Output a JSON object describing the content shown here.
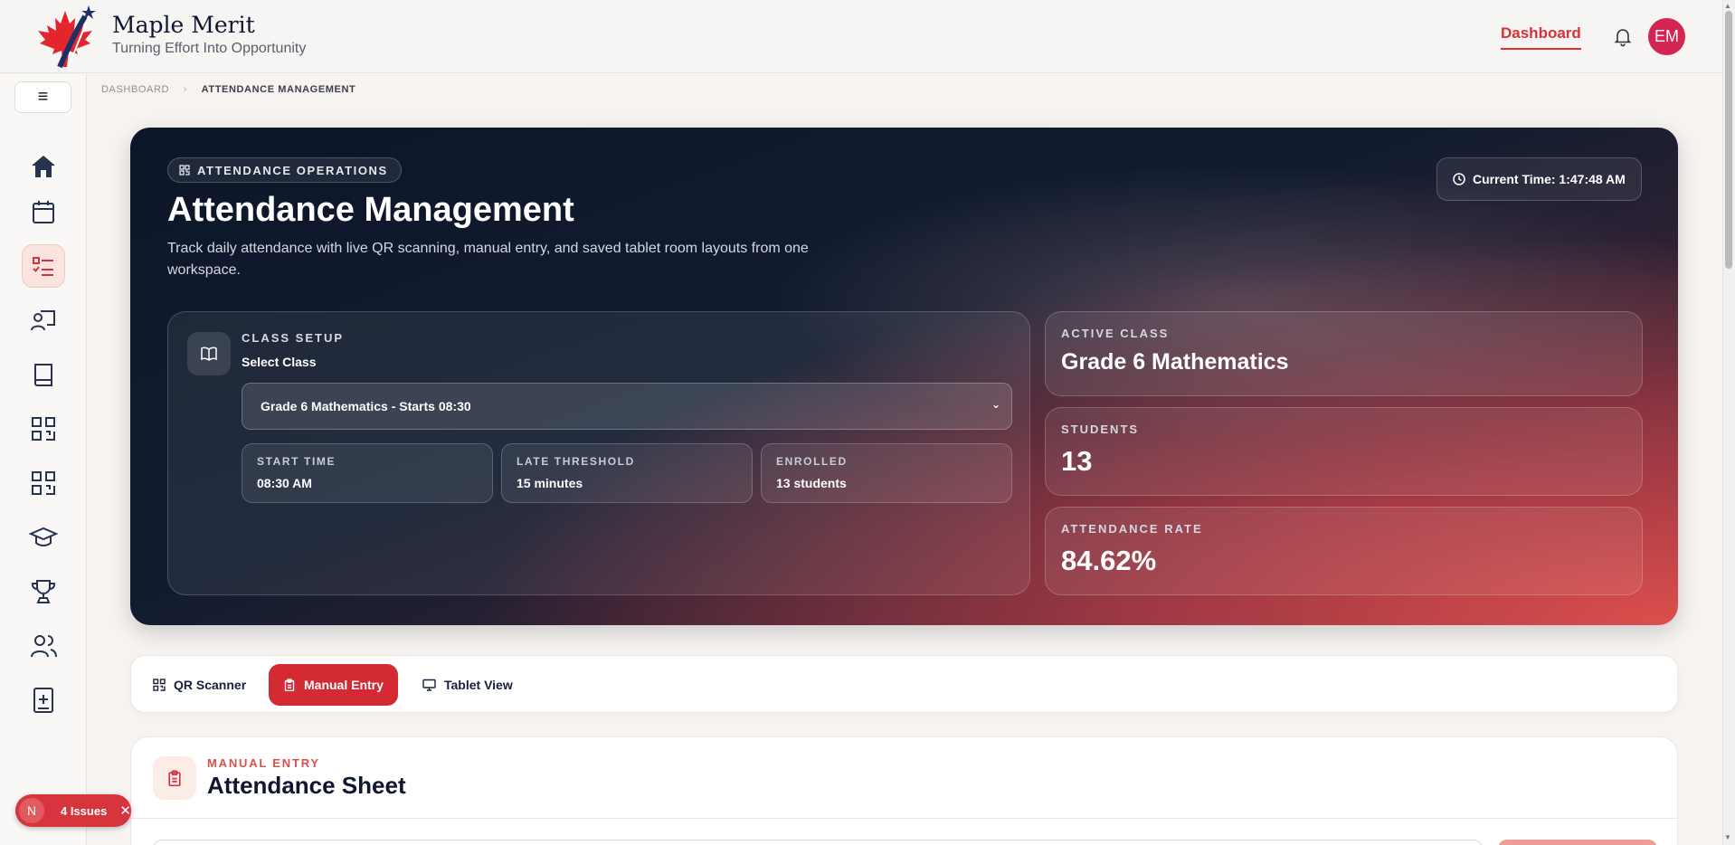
{
  "header": {
    "brand_name": "Maple Merit",
    "brand_tagline": "Turning Effort Into Opportunity",
    "nav_dashboard": "Dashboard",
    "avatar_initials": "EM"
  },
  "sidebar": {
    "menu_icon": "hamburger-icon",
    "items": [
      {
        "name": "home",
        "icon": "home-icon",
        "active": false
      },
      {
        "name": "calendar",
        "icon": "calendar-icon",
        "active": false
      },
      {
        "name": "attendance",
        "icon": "checklist-icon",
        "active": true
      },
      {
        "name": "teacher",
        "icon": "presenter-icon",
        "active": false
      },
      {
        "name": "book",
        "icon": "book-icon",
        "active": false
      },
      {
        "name": "qr-1",
        "icon": "qr-code-icon",
        "active": false
      },
      {
        "name": "qr-2",
        "icon": "qr-code-icon",
        "active": false
      },
      {
        "name": "graduation",
        "icon": "graduation-cap-icon",
        "active": false
      },
      {
        "name": "trophy",
        "icon": "trophy-icon",
        "active": false
      },
      {
        "name": "users",
        "icon": "users-icon",
        "active": false
      },
      {
        "name": "add-report",
        "icon": "add-document-icon",
        "active": false
      }
    ]
  },
  "breadcrumb": {
    "home": "DASHBOARD",
    "current": "ATTENDANCE MANAGEMENT"
  },
  "hero": {
    "badge": "ATTENDANCE OPERATIONS",
    "title": "Attendance Management",
    "subtitle": "Track daily attendance with live QR scanning, manual entry, and saved tablet room layouts from one workspace.",
    "current_time": "Current Time: 1:47:48 AM",
    "class_setup": {
      "label": "CLASS SETUP",
      "select_label": "Select Class",
      "selected_class": "Grade 6 Mathematics - Starts 08:30",
      "start_time_label": "START TIME",
      "start_time": "08:30 AM",
      "late_label": "LATE THRESHOLD",
      "late_value": "15 minutes",
      "enrolled_label": "ENROLLED",
      "enrolled_value": "13 students"
    },
    "stats": {
      "active_class_label": "ACTIVE CLASS",
      "active_class": "Grade 6 Mathematics",
      "students_label": "STUDENTS",
      "students": "13",
      "rate_label": "ATTENDANCE RATE",
      "rate": "84.62%"
    }
  },
  "tabs": [
    {
      "label": "QR Scanner",
      "icon": "qr-code-icon",
      "active": false
    },
    {
      "label": "Manual Entry",
      "icon": "clipboard-icon",
      "active": true
    },
    {
      "label": "Tablet View",
      "icon": "monitor-icon",
      "active": false
    }
  ],
  "sheet": {
    "kicker": "MANUAL ENTRY",
    "title": "Attendance Sheet"
  },
  "issues": {
    "badge": "N",
    "label": "4 Issues"
  },
  "colors": {
    "accent": "#d5323a",
    "hero_dark": "#0d1629",
    "hero_red": "#dc4f4c",
    "avatar": "#d42653"
  }
}
